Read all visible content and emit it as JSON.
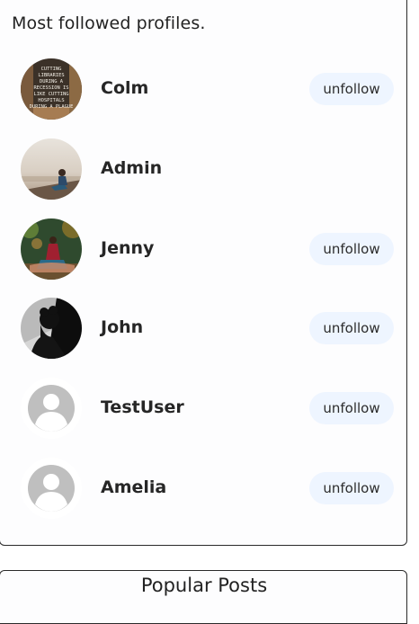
{
  "followed_card": {
    "title": "Most followed profiles."
  },
  "profiles": [
    {
      "name": "Colm",
      "avatar": "book-quote-poster",
      "button_label": "unfollow",
      "has_button": true,
      "avatar_text": "CUTTING LIBRARIES DURING A RECESSION IS LIKE CUTTING HOSPITALS DURING A PLAGUE"
    },
    {
      "name": "Admin",
      "avatar": "person-on-cliff-city-photo",
      "has_button": false
    },
    {
      "name": "Jenny",
      "avatar": "woman-in-forest-photo",
      "button_label": "unfollow",
      "has_button": true
    },
    {
      "name": "John",
      "avatar": "man-silhouette-photo",
      "button_label": "unfollow",
      "has_button": true
    },
    {
      "name": "TestUser",
      "avatar": "default-user-icon",
      "button_label": "unfollow",
      "has_button": true
    },
    {
      "name": "Amelia",
      "avatar": "default-user-icon",
      "button_label": "unfollow",
      "has_button": true
    }
  ],
  "popular_card": {
    "title": "Popular Posts"
  },
  "colors": {
    "button_bg": "#eef5ff",
    "card_border": "#2a2a2a",
    "default_avatar": "#bfbfbf"
  }
}
